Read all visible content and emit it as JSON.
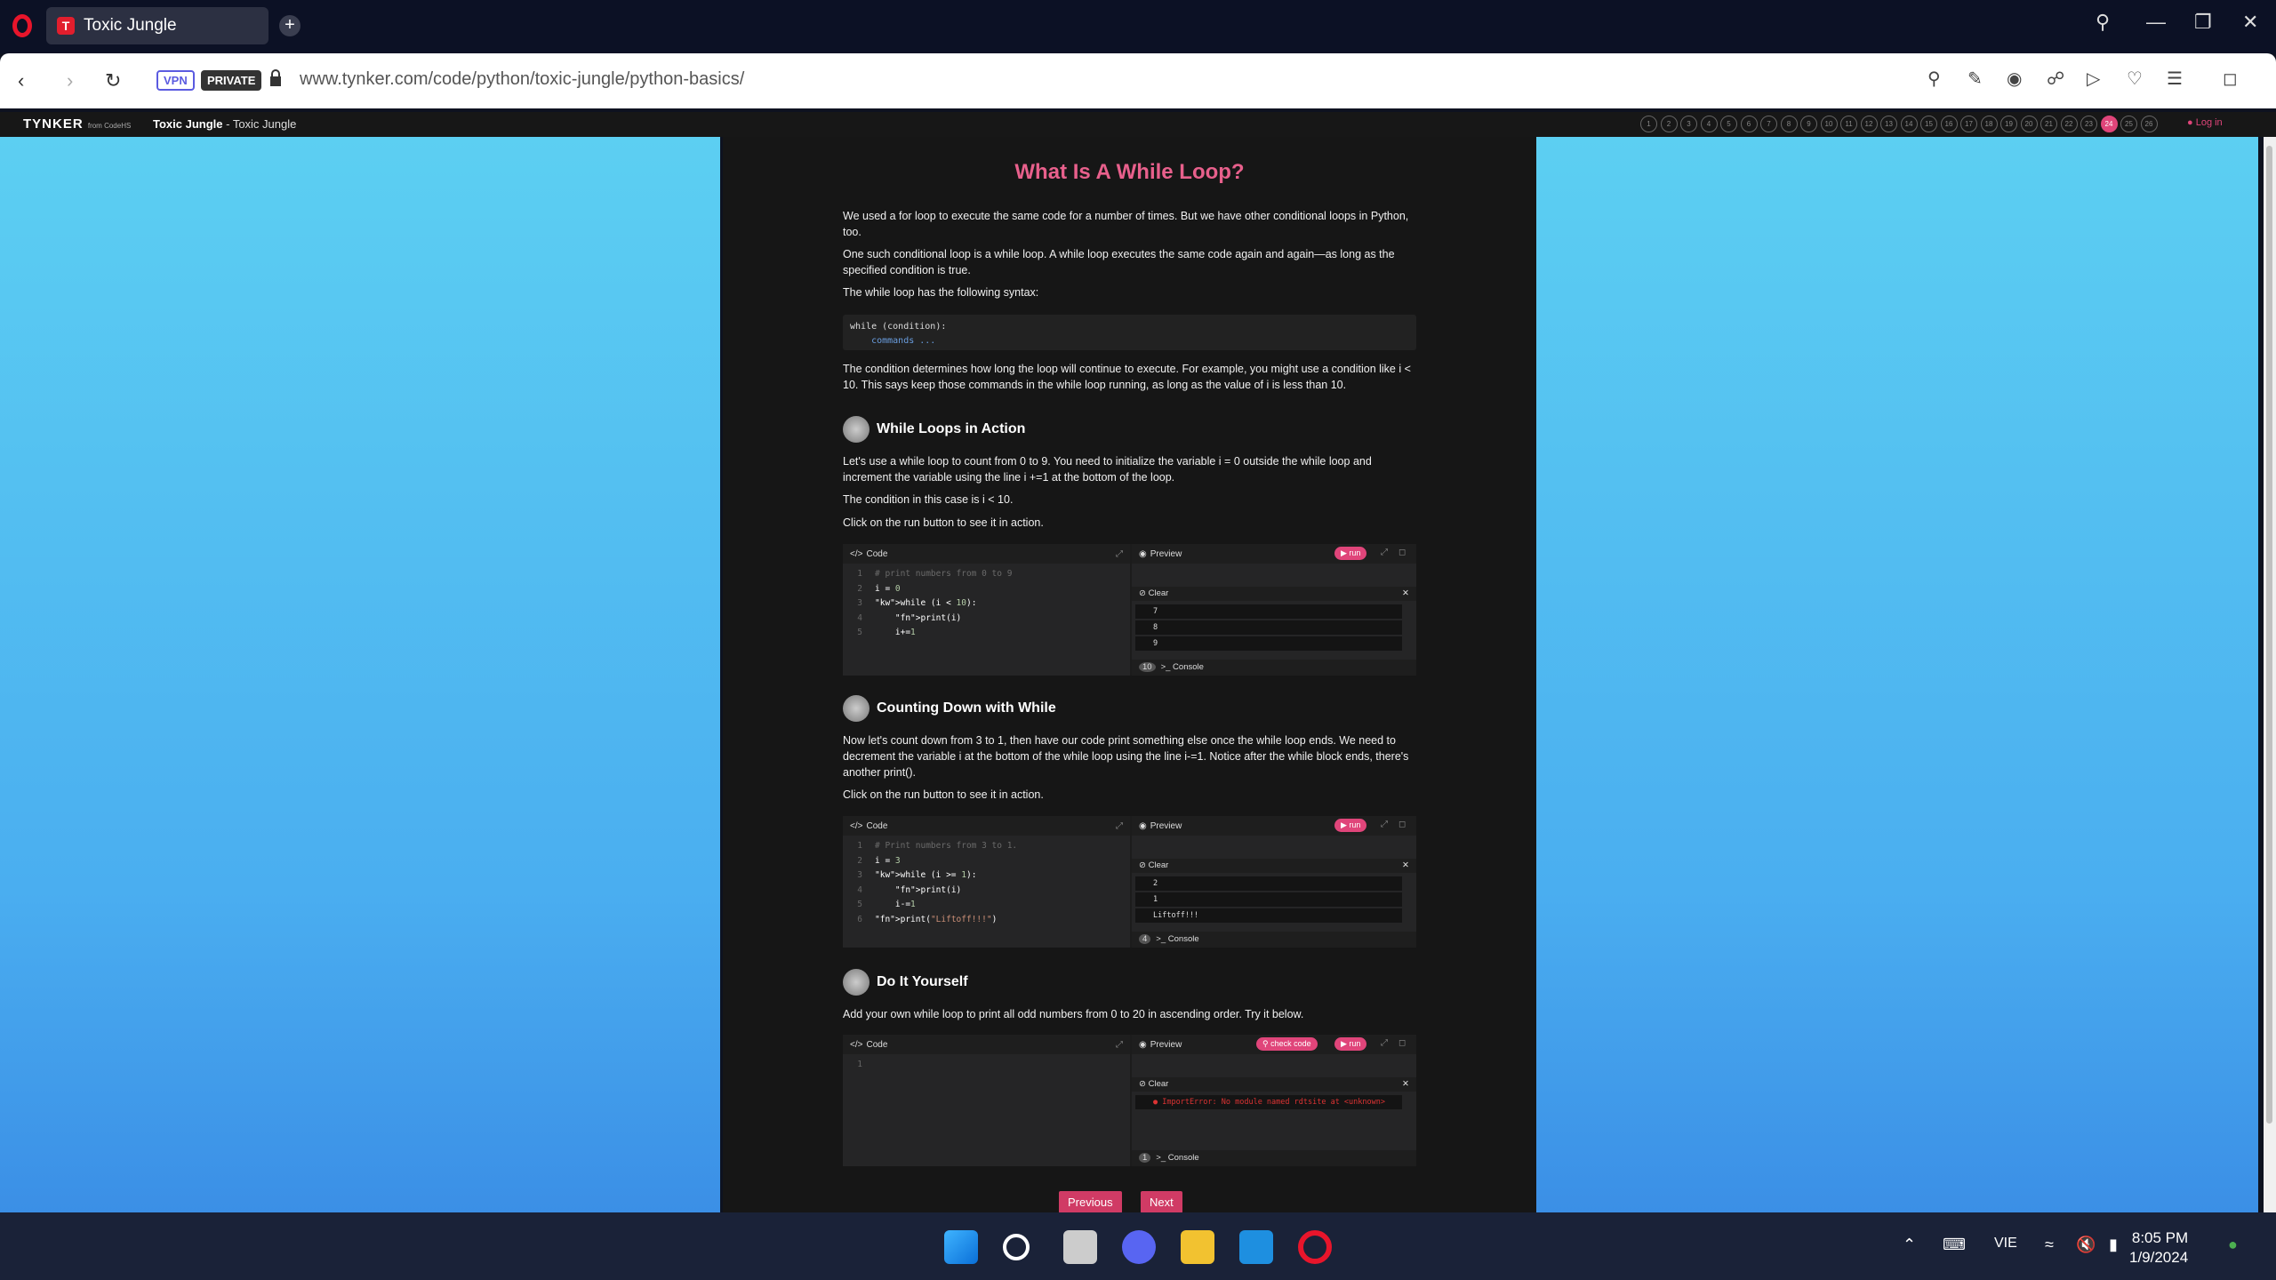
{
  "browser": {
    "tab_title": "Toxic Jungle",
    "tab_favicon": "T",
    "new_tab": "+",
    "vpn": "VPN",
    "private": "PRIVATE",
    "url": "www.tynker.com/code/python/toxic-jungle/python-basics/"
  },
  "site": {
    "logo": "TYNKER",
    "logo_from": "from CodeHS",
    "breadcrumb_bold": "Toxic Jungle",
    "breadcrumb_rest": " - Toxic Jungle",
    "steps": [
      "1",
      "2",
      "3",
      "4",
      "5",
      "6",
      "7",
      "8",
      "9",
      "10",
      "11",
      "12",
      "13",
      "14",
      "15",
      "16",
      "17",
      "18",
      "19",
      "20",
      "21",
      "22",
      "23",
      "24",
      "25",
      "26"
    ],
    "active_step": "24",
    "login": "Log in"
  },
  "lesson": {
    "title": "What Is A While Loop?",
    "p1": "We used a for loop to execute the same code for a number of times. But we have other conditional loops in Python, too.",
    "p2": "One such conditional loop is a while loop. A while loop executes the same code again and again—as long as the specified condition is true.",
    "p3": "The while loop has the following syntax:",
    "syntax_line1": "while (condition):",
    "syntax_line2": "    commands ...",
    "p4": "The condition determines how long the loop will continue to execute. For example, you might use a condition like i < 10. This says keep those commands in the while loop running, as long as the value of i is less than 10.",
    "s1_title": "While Loops in Action",
    "s1_p1": "Let's use a while loop to count from 0 to 9. You need to initialize the variable i = 0 outside the while loop and increment the variable using the line i +=1 at the bottom of the loop.",
    "s1_p2": "The condition in this case is i < 10.",
    "s1_p3": "Click on the run button to see it in action.",
    "s2_title": "Counting Down with While",
    "s2_p1": "Now let's count down from 3 to 1, then have our code print something else once the while loop ends. We need to decrement the variable i at the bottom of the while loop using the line i-=1. Notice after the while block ends, there's another print().",
    "s2_p2": "Click on the run button to see it in action.",
    "s3_title": "Do It Yourself",
    "s3_p1": "Add your own while loop to print all odd numbers from 0 to 20 in ascending order. Try it below."
  },
  "widget_labels": {
    "code": "Code",
    "preview": "Preview",
    "run": "▶ run",
    "check": "check code",
    "clear": "Clear",
    "console": "Console"
  },
  "widget1": {
    "lines": [
      "# print numbers from 0 to 9",
      "i = 0",
      "while (i < 10):",
      "    print(i)",
      "    i+=1"
    ],
    "output": [
      "7",
      "8",
      "9"
    ],
    "console_count": "10"
  },
  "widget2": {
    "lines": [
      "# Print numbers from 3 to 1.",
      "i = 3",
      "while (i >= 1):",
      "    print(i)",
      "    i-=1",
      "print(\"Liftoff!!!\")"
    ],
    "output": [
      "2",
      "1",
      "Liftoff!!!"
    ],
    "console_count": "4"
  },
  "widget3": {
    "lines": [
      ""
    ],
    "error": "ImportError: No module named rdtsite at <unknown>",
    "console_count": "1"
  },
  "nav": {
    "previous": "Previous",
    "next": "Next"
  },
  "taskbar": {
    "lang": "VIE",
    "time": "8:05 PM",
    "date": "1/9/2024"
  }
}
